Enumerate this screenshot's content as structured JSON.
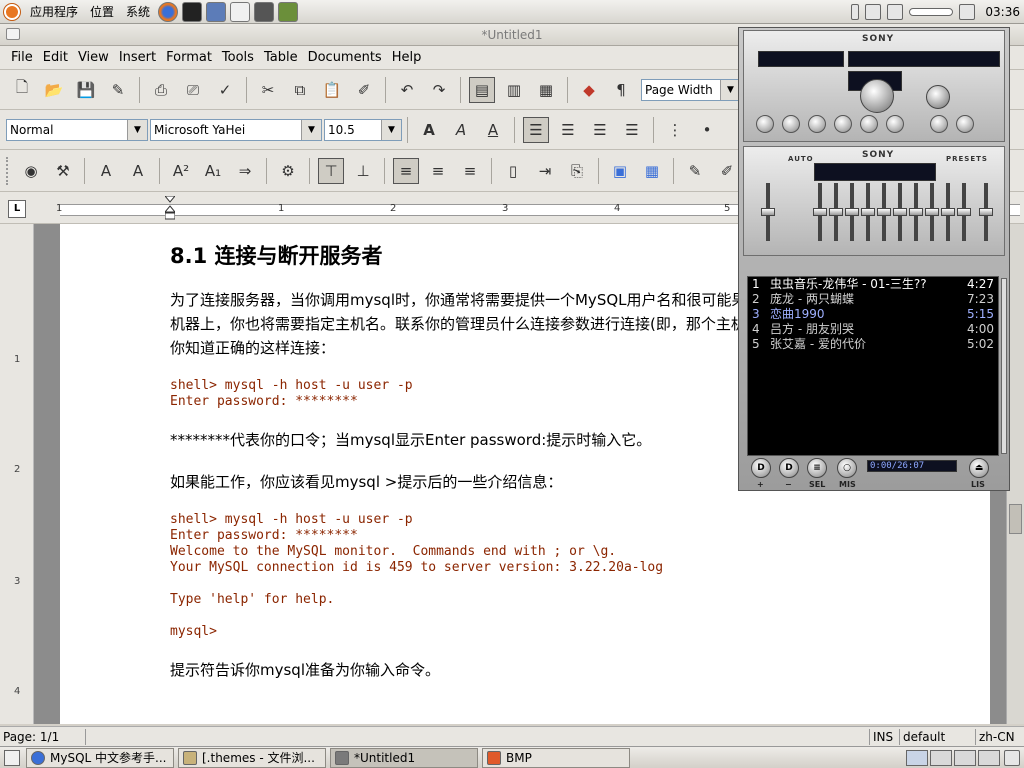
{
  "top_panel": {
    "menus": [
      "应用程序",
      "位置",
      "系统"
    ],
    "clock": "03:36"
  },
  "window": {
    "title": "*Untitled1",
    "menus": [
      "File",
      "Edit",
      "View",
      "Insert",
      "Format",
      "Tools",
      "Table",
      "Documents",
      "Help"
    ],
    "zoom": "Page Width",
    "style": "Normal",
    "font": "Microsoft YaHei",
    "font_size": "10.5"
  },
  "ruler": {
    "corner": "L",
    "numbers": [
      "1",
      "1",
      "2",
      "3",
      "4",
      "5"
    ],
    "vnumbers": [
      "1",
      "2",
      "3",
      "4"
    ]
  },
  "document": {
    "heading": "8.1 连接与断开服务者",
    "para1": "为了连接服务器，当你调用mysql时，你通常将需要提供一个MySQL用户名和很可能果服务器运行在不是你登录的一台机器上，你也将需要指定主机名。联系你的管理员什么连接参数进行连接(即，那个主机，用户名字和使用的口令)。一旦你知道正确的这样连接：",
    "code1": "shell> mysql -h host -u user -p\nEnter password: ********",
    "para2": "********代表你的口令；当mysql显示Enter password:提示时输入它。",
    "para3": "如果能工作，你应该看见mysql >提示后的一些介绍信息：",
    "code2": "shell> mysql -h host -u user -p\nEnter password: ********\nWelcome to the MySQL monitor.  Commands end with ; or \\g.\nYour MySQL connection id is 459 to server version: 3.22.20a-log\n\nType 'help' for help.\n\nmysql>",
    "para4": "提示符告诉你mysql准备为你输入命令。"
  },
  "status": {
    "page": "Page: 1/1",
    "mode": "INS",
    "style": "default",
    "lang": "zh-CN"
  },
  "taskbar": {
    "tasks": [
      {
        "label": "MySQL 中文参考手...",
        "color": "#3a6fd8"
      },
      {
        "label": "[.themes - 文件浏...",
        "color": "#c8b27a"
      },
      {
        "label": "*Untitled1",
        "color": "#7a7a7a"
      },
      {
        "label": "BMP",
        "color": "#e05a2a"
      }
    ]
  },
  "player": {
    "brand": "SONY",
    "eq_auto": "AUTO",
    "eq_presets": "PRESETS",
    "time": "0:00/26:07",
    "playlist": [
      {
        "num": "1",
        "title": "虫虫音乐-龙伟华 - 01-三生??",
        "dur": "4:27"
      },
      {
        "num": "2",
        "title": "庞龙 - 两只蝴蝶",
        "dur": "7:23"
      },
      {
        "num": "3",
        "title": "恋曲1990",
        "dur": "5:15"
      },
      {
        "num": "4",
        "title": "吕方 - 朋友别哭",
        "dur": "4:00"
      },
      {
        "num": "5",
        "title": "张艾嘉 - 爱的代价",
        "dur": "5:02"
      }
    ],
    "controls": [
      "+",
      "−",
      "SEL",
      "MIS",
      "LIS"
    ]
  }
}
